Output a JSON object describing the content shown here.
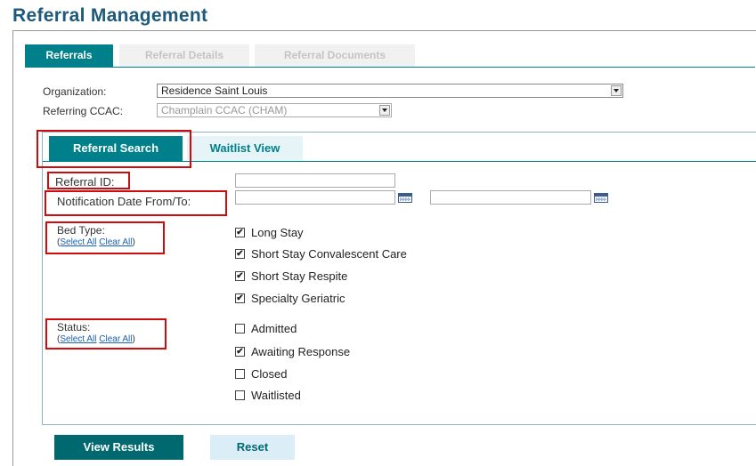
{
  "page": {
    "title": "Referral Management"
  },
  "tabs": [
    "Referrals",
    "Referral Details",
    "Referral Documents"
  ],
  "org": {
    "organization_label": "Organization:",
    "organization_value": "Residence Saint Louis",
    "ccac_label": "Referring CCAC:",
    "ccac_value": "Champlain CCAC (CHAM)"
  },
  "subtabs": [
    "Referral Search",
    "Waitlist View"
  ],
  "search": {
    "referral_id_label": "Referral ID:",
    "referral_id_value": "",
    "notification_label": "Notification Date From/To:",
    "date_from": "",
    "date_to": "",
    "bed_type_label": "Bed Type:",
    "status_label": "Status:",
    "select_all": "Select All",
    "clear_all": "Clear All",
    "paren_open": "(",
    "paren_close": ")"
  },
  "bed_types": [
    {
      "label": "Long Stay",
      "checked": true
    },
    {
      "label": "Short Stay Convalescent Care",
      "checked": true
    },
    {
      "label": "Short Stay Respite",
      "checked": true
    },
    {
      "label": "Specialty Geriatric",
      "checked": true
    }
  ],
  "statuses": [
    {
      "label": "Admitted",
      "checked": false
    },
    {
      "label": "Awaiting Response",
      "checked": true
    },
    {
      "label": "Closed",
      "checked": false
    },
    {
      "label": "Waitlisted",
      "checked": false
    }
  ],
  "buttons": {
    "view_results": "View Results",
    "reset": "Reset"
  },
  "icons": {
    "checkmark": "✔",
    "calendar": "calendar-icon",
    "dropdown": "chevron-down-icon"
  },
  "colors": {
    "title": "#1d5a7a",
    "accent": "#00808a",
    "highlight": "#d10b0b"
  }
}
